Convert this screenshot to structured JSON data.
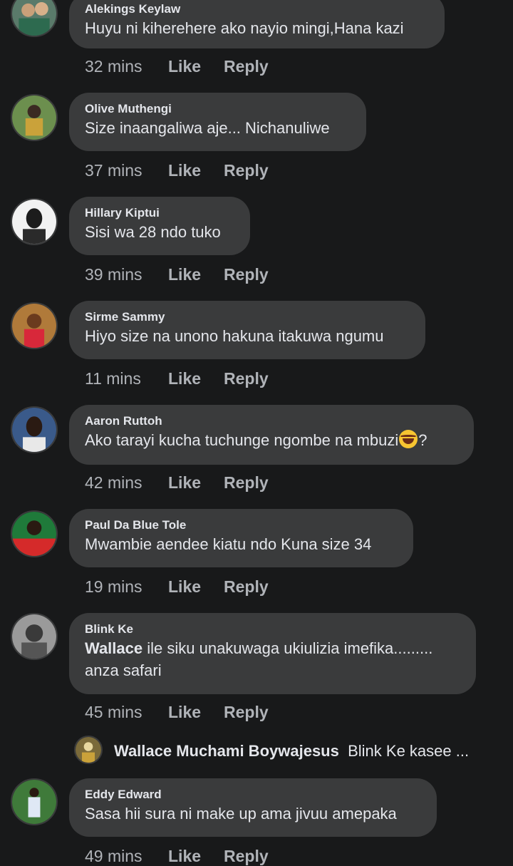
{
  "actions": {
    "like_label": "Like",
    "reply_label": "Reply"
  },
  "comments": [
    {
      "author": "Alekings Keylaw",
      "text": "Huyu ni kiherehere ako nayio mingi,Hana kazi",
      "time": "32 mins"
    },
    {
      "author": "Olive Muthengi",
      "text": "Size inaangaliwa aje... Nichanuliwe",
      "time": "37 mins"
    },
    {
      "author": "Hillary Kiptui",
      "text": "Sisi wa 28 ndo tuko",
      "time": "39 mins"
    },
    {
      "author": "Sirme Sammy",
      "text": "Hiyo size na unono hakuna itakuwa ngumu",
      "time": "11 mins"
    },
    {
      "author": "Aaron Ruttoh",
      "text": "Ako tarayi kucha tuchunge ngombe na mbuzi",
      "text_suffix": "?",
      "emoji": "joy-emoji",
      "time": "42 mins"
    },
    {
      "author": "Paul Da Blue Tole",
      "text": "Mwambie aendee kiatu ndo Kuna size 34",
      "time": "19 mins"
    },
    {
      "author": "Blink Ke",
      "mention": "Wallace",
      "text": " ile siku unakuwaga ukiulizia imefika.........",
      "text_line2": "anza safari",
      "time": "45 mins"
    },
    {
      "author": "Eddy Edward",
      "text": "Sasa hii sura ni make up ama jivuu amepaka",
      "time": "49 mins"
    }
  ],
  "reply_preview": {
    "author": "Wallace Muchami Boywajesus",
    "text": "Blink Ke kasee ..."
  }
}
